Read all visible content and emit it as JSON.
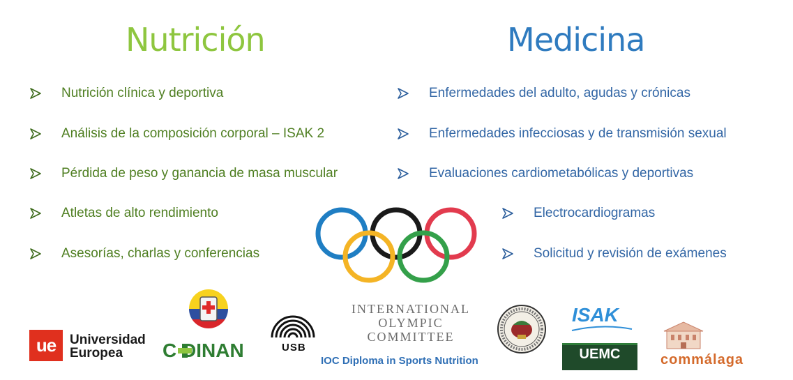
{
  "nutrition": {
    "heading": "Nutrición",
    "items": [
      "Nutrición clínica y deportiva",
      "Análisis de la composición corporal – ISAK 2",
      "Pérdida de peso y ganancia de masa muscular",
      "Atletas de alto rendimiento",
      "Asesorías, charlas y conferencias"
    ]
  },
  "medicine": {
    "heading": "Medicina",
    "items": [
      "Enfermedades del adulto, agudas y crónicas",
      "Enfermedades infecciosas y de transmisión sexual",
      "Evaluaciones cardiometabólicas y deportivas",
      "Electrocardiogramas",
      "Solicitud y revisión de exámenes"
    ]
  },
  "logos": {
    "ue_mark": "ue",
    "ue_line1": "Universidad",
    "ue_line2": "Europea",
    "codinan": "C DINAN",
    "usb": "USB",
    "ioc_line1": "INTERNATIONAL",
    "ioc_line2": "OLYMPIC",
    "ioc_line3": "COMMITTEE",
    "ioc_diploma": "IOC Diploma in Sports Nutrition",
    "isak": "ISAK",
    "uemc": "UEMC",
    "commalaga": "commálaga"
  },
  "colors": {
    "nutrition": "#8ec63f",
    "nutrition_text": "#4f7f22",
    "medicine": "#2f7bbf",
    "medicine_text": "#3266a5",
    "ring_blue": "#1f7ec3",
    "ring_yellow": "#f4b425",
    "ring_black": "#1a1a1a",
    "ring_green": "#34a04a",
    "ring_red": "#e23b4e"
  },
  "icons": {
    "bullet": "arrowhead-bullet-icon",
    "rings": "olympic-rings-icon"
  }
}
